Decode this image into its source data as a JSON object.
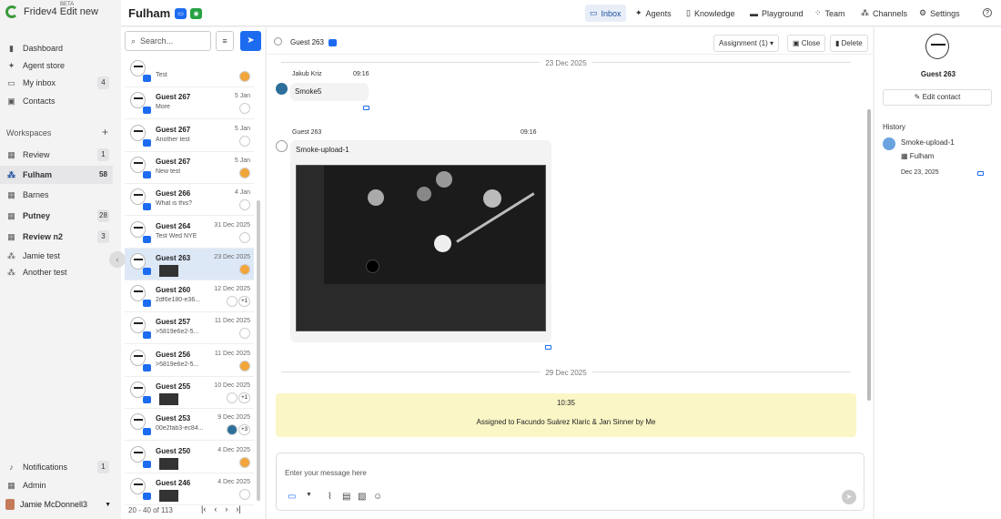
{
  "app": {
    "name": "Fridev4 Edit new",
    "beta": "BETA"
  },
  "sidebar": {
    "items": [
      {
        "label": "Dashboard"
      },
      {
        "label": "Agent store"
      },
      {
        "label": "My inbox",
        "count": "4"
      },
      {
        "label": "Contacts"
      }
    ],
    "workspaces_label": "Workspaces",
    "workspaces": [
      {
        "label": "Review",
        "count": "1"
      },
      {
        "label": "Fulham",
        "count": "58"
      },
      {
        "label": "Barnes"
      },
      {
        "label": "Putney",
        "count": "28"
      },
      {
        "label": "Review n2",
        "count": "3"
      },
      {
        "label": "Jamie test"
      },
      {
        "label": "Another test"
      }
    ],
    "notifications": {
      "label": "Notifications",
      "count": "1"
    },
    "admin": "Admin",
    "user": "Jamie McDonnell3"
  },
  "topbar": {
    "workspace": "Fulham",
    "nav": [
      "Inbox",
      "Agents",
      "Knowledge",
      "Playground",
      "Team",
      "Channels",
      "Settings"
    ],
    "active": "Inbox",
    "help": "?"
  },
  "list": {
    "search_placeholder": "Search...",
    "conversations": [
      {
        "name": "",
        "preview": "Test",
        "date": ""
      },
      {
        "name": "Guest 267",
        "preview": "More",
        "date": "5 Jan"
      },
      {
        "name": "Guest 267",
        "preview": "Another test",
        "date": "5 Jan"
      },
      {
        "name": "Guest 267",
        "preview": "New test",
        "date": "5 Jan"
      },
      {
        "name": "Guest 266",
        "preview": "What is this?",
        "date": "4 Jan"
      },
      {
        "name": "Guest 264",
        "preview": "Test Wed NYE",
        "date": "31 Dec 2025"
      },
      {
        "name": "Guest 263",
        "preview": "",
        "date": "23 Dec 2025"
      },
      {
        "name": "Guest 260",
        "preview": "2df6e180-e36...",
        "date": "12 Dec 2025",
        "more": "+1"
      },
      {
        "name": "Guest 257",
        "preview": ">5819e6e2-5...",
        "date": "11 Dec 2025"
      },
      {
        "name": "Guest 256",
        "preview": ">5819e6e2-5...",
        "date": "11 Dec 2025"
      },
      {
        "name": "Guest 255",
        "preview": "",
        "date": "10 Dec 2025",
        "more": "+1"
      },
      {
        "name": "Guest 253",
        "preview": "00e2fab3-ec84...",
        "date": "9 Dec 2025",
        "more": "+3"
      },
      {
        "name": "Guest 250",
        "preview": "",
        "date": "4 Dec 2025"
      },
      {
        "name": "Guest 246",
        "preview": "",
        "date": "4 Dec 2025"
      }
    ],
    "pager": "20 - 40 of 113"
  },
  "chat": {
    "contact": "Guest 263",
    "assignment": "Assignment (1)",
    "close": "Close",
    "delete": "Delete",
    "date1": "23 Dec 2025",
    "msg1": {
      "author": "Jakub Kriz",
      "time": "09:16",
      "text": "Smoke5"
    },
    "msg2": {
      "author": "Guest 263",
      "time": "09:16",
      "text": "Smoke-upload-1"
    },
    "date2": "29 Dec 2025",
    "sys": {
      "time": "10:35",
      "text": "Assigned to Facundo Suárez Klaric & Jan Sinner by Me"
    },
    "composer_placeholder": "Enter your message here"
  },
  "contact_panel": {
    "name": "Guest 263",
    "edit": "Edit contact",
    "history_label": "History",
    "history": {
      "title": "Smoke-upload-1",
      "workspace": "Fulham",
      "date": "Dec 23, 2025"
    }
  },
  "colors": {
    "accent": "#1d6cf0",
    "system_note": "#fbf6c6",
    "selected_row": "#dde8f7"
  }
}
